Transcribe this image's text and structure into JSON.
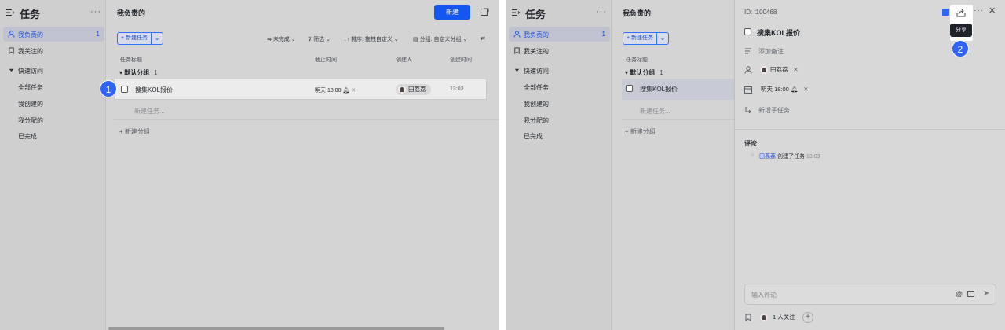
{
  "app": {
    "sidebar_title": "任务",
    "more_label": "···",
    "nav": [
      {
        "label": "我负责的",
        "count": "1"
      },
      {
        "label": "我关注的"
      },
      {
        "label": "快速访问"
      },
      {
        "label": "全部任务"
      },
      {
        "label": "我创建的"
      },
      {
        "label": "我分配的"
      },
      {
        "label": "已完成"
      }
    ]
  },
  "main": {
    "title": "我负责的",
    "new_button": "新建",
    "add_task": "+ 新建任务",
    "filters": {
      "status": "未完成",
      "filter": "筛选",
      "sort_prefix": "排序:",
      "sort_value": "拖拽自定义",
      "group_prefix": "分组:",
      "group_value": "自定义分组"
    },
    "columns": {
      "title": "任务标题",
      "due": "截止时间",
      "creator": "创建人",
      "created": "创建时间"
    },
    "group": {
      "name": "默认分组",
      "count": "1"
    },
    "task": {
      "name": "搜集KOL报价",
      "due": "明天 18:00",
      "creator": "田荔荔",
      "created": "13:03"
    },
    "new_task_placeholder": "新建任务...",
    "new_group": "+ 新建分组"
  },
  "detail": {
    "id": "ID: t100468",
    "title": "搜集KOL报价",
    "add_note": "添加备注",
    "assignee": "田荔荔",
    "due": "明天 18:00",
    "add_subtask": "新增子任务",
    "comments_heading": "评论",
    "activity_user": "田荔荔",
    "activity_text": "创建了任务",
    "activity_time": "13:03",
    "comment_placeholder": "输入评论",
    "followers": "1 人关注",
    "share_tooltip": "分享"
  },
  "steps": [
    "1",
    "2"
  ],
  "colors": {
    "accent": "#1456f0",
    "badge": "#2f64f5"
  }
}
